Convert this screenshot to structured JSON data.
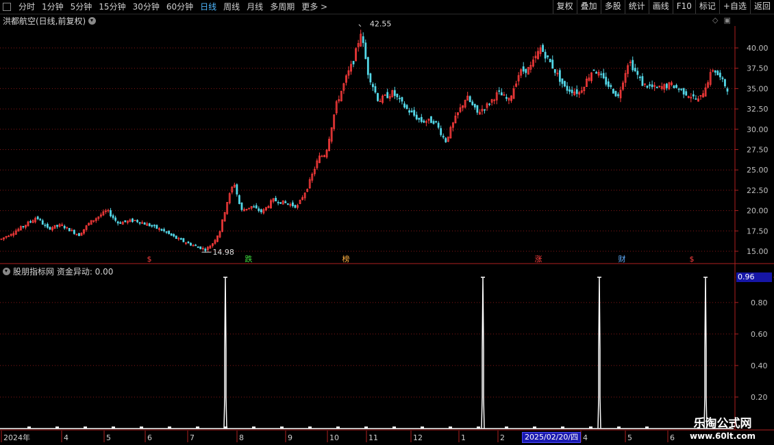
{
  "periods": [
    "分时",
    "1分钟",
    "5分钟",
    "15分钟",
    "30分钟",
    "60分钟",
    "日线",
    "周线",
    "月线",
    "多周期",
    "更多 >"
  ],
  "active_period": "日线",
  "toolbar_buttons": [
    "复权",
    "叠加",
    "多股",
    "统计",
    "画线",
    "F10",
    "标记",
    "+自选",
    "返回"
  ],
  "stock_title": "洪都航空(日线,前复权)",
  "indicator_title": "股朋指标网  资金异动: 0.00",
  "indicator_value_box": "0.96",
  "price_high_label": "42.55",
  "price_low_label": "14.98",
  "price_axis": [
    "40.00",
    "37.50",
    "35.00",
    "32.50",
    "30.00",
    "27.50",
    "25.00",
    "22.50",
    "20.00",
    "17.50",
    "15.00"
  ],
  "indicator_axis": [
    "0.80",
    "0.60",
    "0.40",
    "0.20"
  ],
  "event_markers": [
    {
      "text": "$",
      "color": "#ff4040"
    },
    {
      "text": "跌",
      "color": "#40e040"
    },
    {
      "text": "榜",
      "color": "#ffb040"
    },
    {
      "text": "涨",
      "color": "#ff4040"
    },
    {
      "text": "财",
      "color": "#60b0ff"
    },
    {
      "text": "$",
      "color": "#ff4040"
    }
  ],
  "x_axis_labels": [
    "2024年",
    "4",
    "5",
    "6",
    "7",
    "8",
    "9",
    "10",
    "11",
    "12",
    "1",
    "2",
    "3",
    "4",
    "5",
    "6"
  ],
  "highlighted_date": "2025/02/20/四",
  "watermark": {
    "line1": "乐淘公式网",
    "line2": "www.60lt.com"
  },
  "colors": {
    "up": "#ff3c3c",
    "down": "#54d8e8",
    "grid": "#8a1818",
    "axis": "#b02020",
    "spike": "#ffffff"
  },
  "chart_data": {
    "type": "candlestick",
    "title": "洪都航空(日线,前复权)",
    "ylim": [
      14.0,
      43.0
    ],
    "price_path": [
      [
        2024.2,
        16.5
      ],
      [
        2024.26,
        18.0
      ],
      [
        2024.3,
        19.2
      ],
      [
        2024.33,
        17.8
      ],
      [
        2024.37,
        18.2
      ],
      [
        2024.42,
        17.0
      ],
      [
        2024.45,
        18.5
      ],
      [
        2024.5,
        20.0
      ],
      [
        2024.53,
        18.5
      ],
      [
        2024.58,
        18.8
      ],
      [
        2024.62,
        18.2
      ],
      [
        2024.66,
        17.5
      ],
      [
        2024.7,
        16.5
      ],
      [
        2024.74,
        15.8
      ],
      [
        2024.78,
        15.2
      ],
      [
        2024.8,
        16.0
      ],
      [
        2024.82,
        17.5
      ],
      [
        2024.84,
        21.0
      ],
      [
        2024.86,
        23.5
      ],
      [
        2024.88,
        20.0
      ],
      [
        2024.91,
        20.5
      ],
      [
        2024.94,
        19.8
      ],
      [
        2024.97,
        21.3
      ],
      [
        2025.0,
        21.0
      ],
      [
        2025.04,
        20.5
      ],
      [
        2025.07,
        23.0
      ],
      [
        2025.1,
        26.5
      ],
      [
        2025.12,
        27.0
      ],
      [
        2025.15,
        33.0
      ],
      [
        2025.18,
        36.5
      ],
      [
        2025.2,
        38.5
      ],
      [
        2025.22,
        42.0
      ],
      [
        2025.24,
        37.0
      ],
      [
        2025.27,
        33.5
      ],
      [
        2025.31,
        34.5
      ],
      [
        2025.35,
        32.5
      ],
      [
        2025.39,
        31.0
      ],
      [
        2025.43,
        31.0
      ],
      [
        2025.46,
        28.5
      ],
      [
        2025.49,
        31.5
      ],
      [
        2025.52,
        34.0
      ],
      [
        2025.55,
        32.0
      ],
      [
        2025.58,
        33.0
      ],
      [
        2025.61,
        34.5
      ],
      [
        2025.64,
        33.5
      ],
      [
        2025.67,
        37.0
      ],
      [
        2025.7,
        37.5
      ],
      [
        2025.73,
        40.0
      ],
      [
        2025.76,
        38.0
      ],
      [
        2025.8,
        35.0
      ],
      [
        2025.84,
        34.5
      ],
      [
        2025.88,
        37.5
      ],
      [
        2025.92,
        35.5
      ],
      [
        2025.95,
        34.0
      ],
      [
        2025.98,
        38.5
      ],
      [
        2026.02,
        35.5
      ],
      [
        2026.06,
        35.0
      ],
      [
        2026.1,
        35.5
      ],
      [
        2026.14,
        34.5
      ],
      [
        2026.18,
        33.5
      ],
      [
        2026.22,
        37.5
      ],
      [
        2026.26,
        35.0
      ]
    ],
    "high_point": 42.55,
    "low_point": 14.98
  },
  "indicator_data": {
    "type": "bar",
    "name": "资金异动",
    "ylim": [
      0,
      1.0
    ],
    "spikes": [
      0.96,
      0.96,
      0.96,
      0.96
    ],
    "baseline_dots": 23
  }
}
